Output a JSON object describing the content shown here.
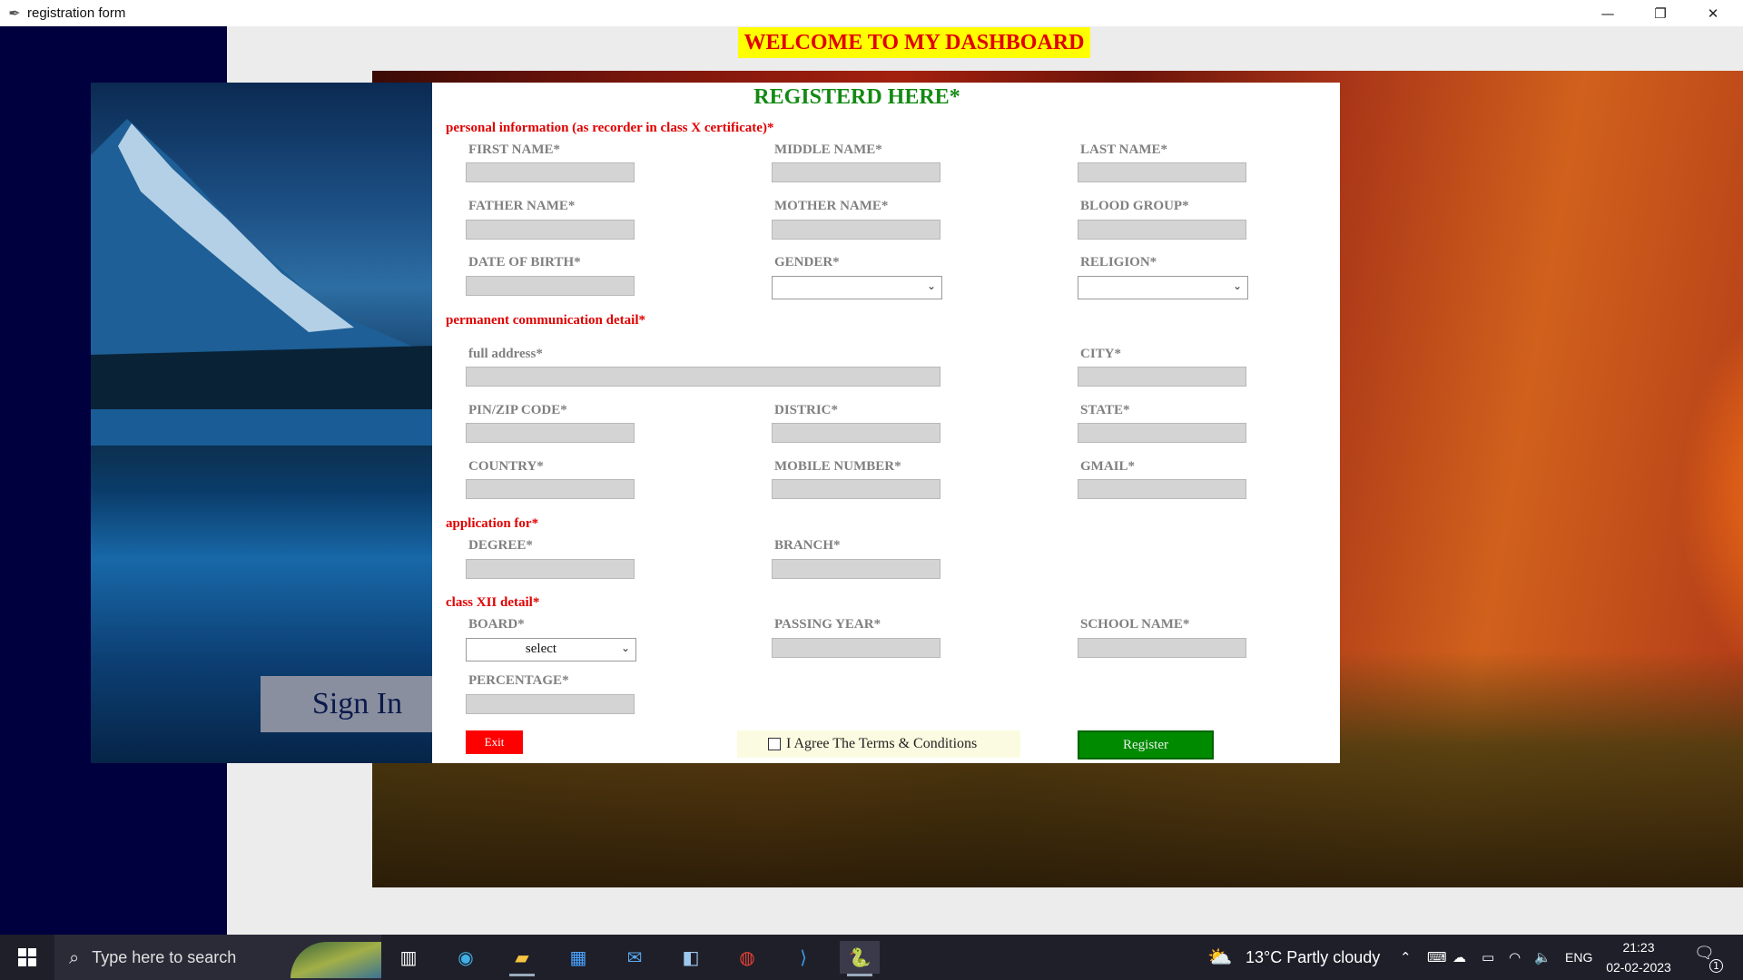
{
  "window": {
    "title": "registration form",
    "controls": {
      "minimize": "—",
      "restore": "❐",
      "close": "✕"
    }
  },
  "dashboard": {
    "welcome": "WELCOME TO MY DASHBOARD"
  },
  "left_panel": {
    "signin_label": "Sign In"
  },
  "form": {
    "title": "REGISTERD HERE*",
    "sections": {
      "personal": "personal information (as recorder in class X certificate)*",
      "communication": "permanent communication detail*",
      "application": "application for*",
      "class_xii": "class XII detail*"
    },
    "labels": {
      "first_name": "FIRST NAME*",
      "middle_name": "MIDDLE NAME*",
      "last_name": "LAST NAME*",
      "father_name": "FATHER NAME*",
      "mother_name": "MOTHER NAME*",
      "blood_group": "BLOOD GROUP*",
      "dob": "DATE OF BIRTH*",
      "gender": "GENDER*",
      "religion": "RELIGION*",
      "full_address": "full address*",
      "city": "CITY*",
      "pin": "PIN/ZIP CODE*",
      "district": "DISTRIC*",
      "state": "STATE*",
      "country": "COUNTRY*",
      "mobile": "MOBILE NUMBER*",
      "gmail": "GMAIL*",
      "degree": "DEGREE*",
      "branch": "BRANCH*",
      "board": "BOARD*",
      "passing_year": "PASSING YEAR*",
      "school_name": "SCHOOL NAME*",
      "percentage": "PERCENTAGE*"
    },
    "selects": {
      "gender": "",
      "religion": "",
      "board": "select"
    },
    "buttons": {
      "exit": "Exit",
      "register": "Register"
    },
    "terms": {
      "label": "I Agree The Terms & Conditions",
      "checked": false
    }
  },
  "taskbar": {
    "search_placeholder": "Type here to search",
    "weather": "13°C  Partly cloudy",
    "language": "ENG",
    "time": "21:23",
    "date": "02-02-2023",
    "notification_count": "1"
  }
}
